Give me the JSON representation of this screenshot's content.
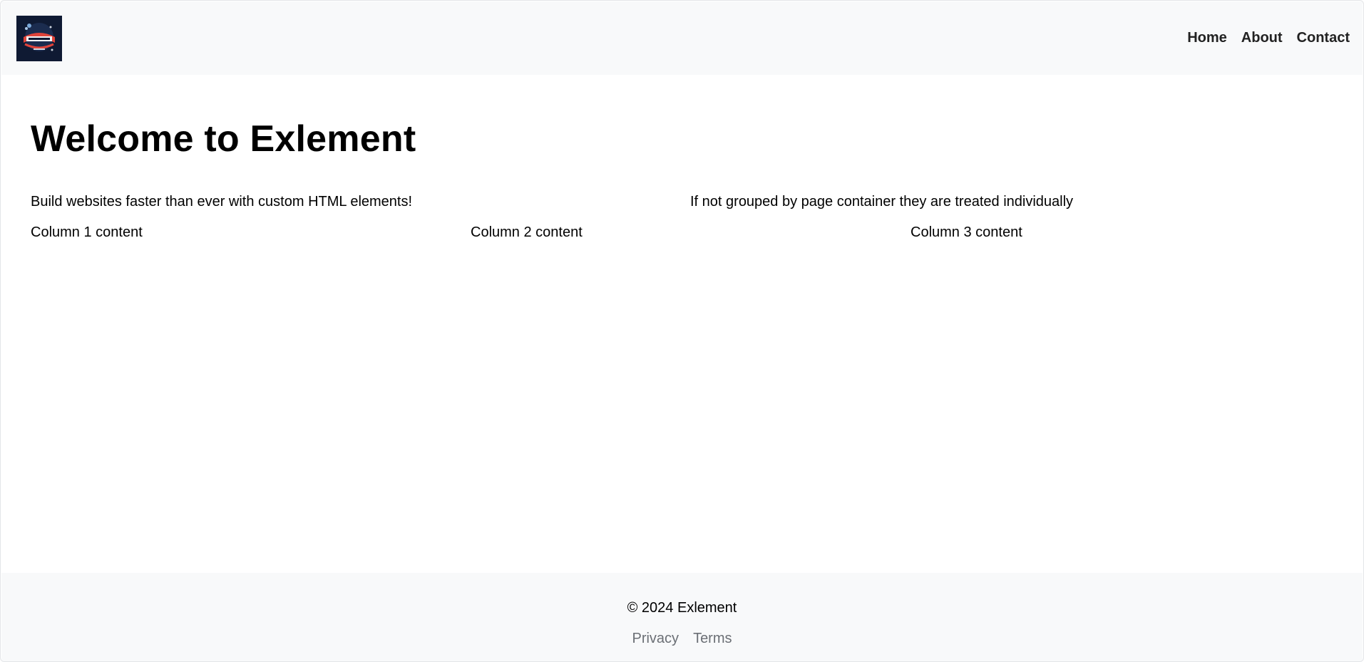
{
  "header": {
    "logo_alt": "Exlement",
    "nav": [
      {
        "label": "Home"
      },
      {
        "label": "About"
      },
      {
        "label": "Contact"
      }
    ]
  },
  "main": {
    "title": "Welcome to Exlement",
    "tagline": "Build websites faster than ever with custom HTML elements!",
    "note": "If not grouped by page container they are treated individually",
    "columns": [
      {
        "text": "Column 1 content"
      },
      {
        "text": "Column 2 content"
      },
      {
        "text": "Column 3 content"
      }
    ]
  },
  "footer": {
    "copyright": "© 2024 Exlement",
    "links": [
      {
        "label": "Privacy"
      },
      {
        "label": "Terms"
      }
    ]
  },
  "colors": {
    "header_bg": "#f8f9fa",
    "footer_bg": "#f8f9fa",
    "logo_bg": "#0f1a33",
    "logo_accent": "#e0443b",
    "link_muted": "#6b6f75"
  }
}
